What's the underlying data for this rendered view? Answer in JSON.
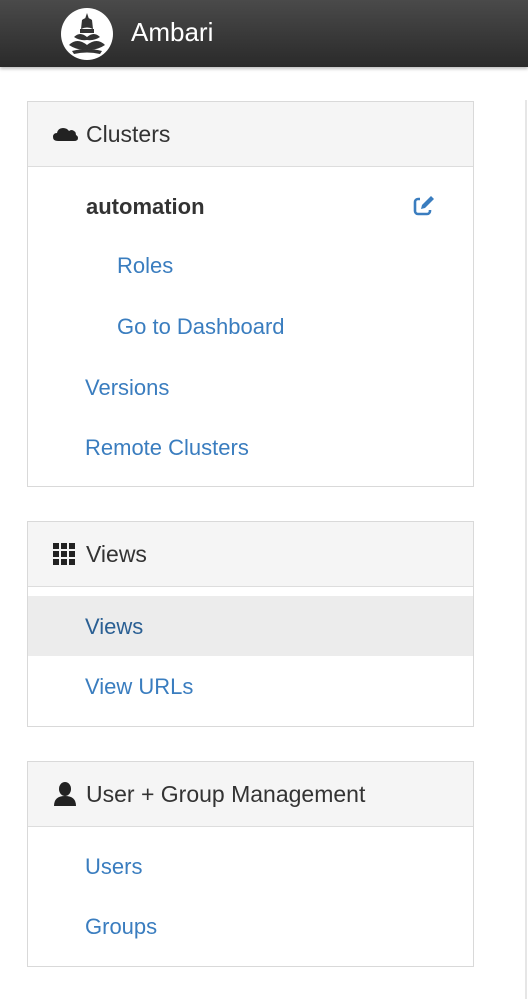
{
  "header": {
    "brand": "Ambari",
    "logo_icon": "ambari-logo-icon"
  },
  "panels": {
    "clusters": {
      "title": "Clusters",
      "icon": "cloud-icon",
      "cluster_name": "automation",
      "edit_icon": "edit-icon",
      "sub_items": [
        "Roles",
        "Go to Dashboard"
      ],
      "items": [
        "Versions",
        "Remote Clusters"
      ]
    },
    "views": {
      "title": "Views",
      "icon": "grid-icon",
      "items": [
        "Views",
        "View URLs"
      ],
      "active_item": "Views"
    },
    "users": {
      "title": "User + Group Management",
      "icon": "user-icon",
      "items": [
        "Users",
        "Groups"
      ]
    }
  },
  "colors": {
    "link": "#3a7dbf",
    "topbar": "#333333",
    "panel_heading_bg": "#f5f5f5",
    "active_row_bg": "#ececec"
  }
}
